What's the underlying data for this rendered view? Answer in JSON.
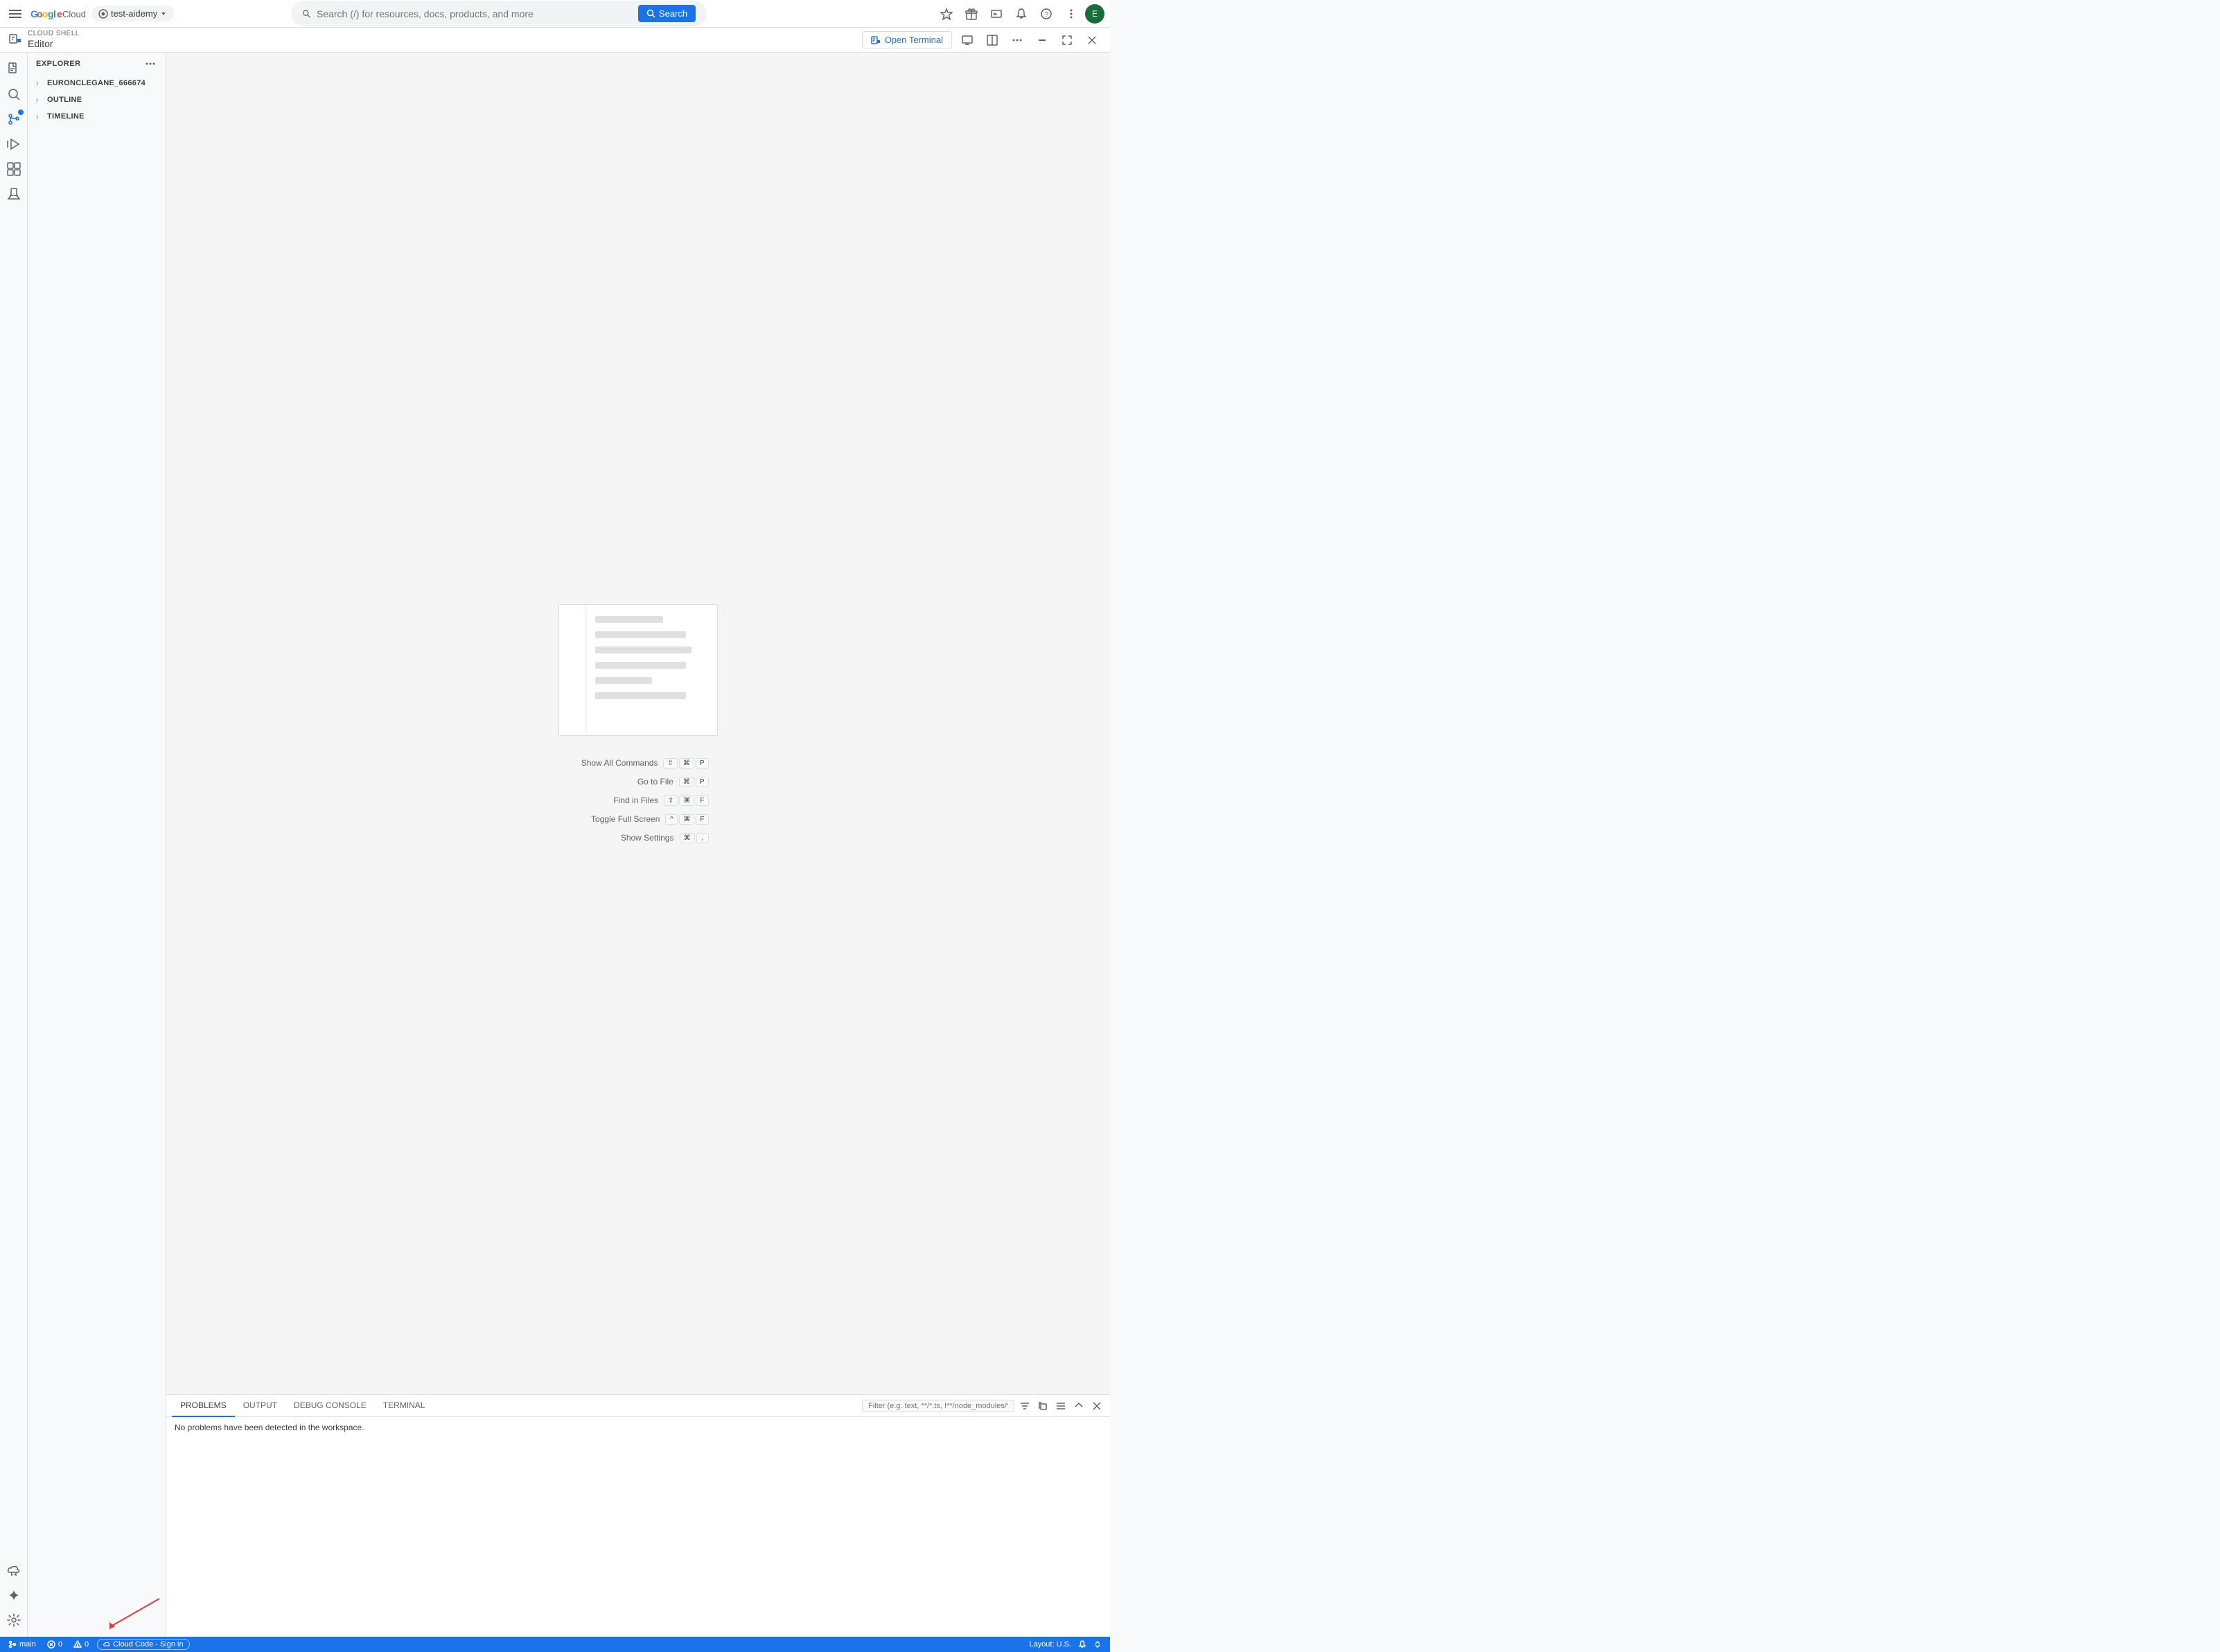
{
  "topbar": {
    "hamburger_label": "☰",
    "logo_text": "Google Cloud",
    "project_name": "test-aidemy",
    "search_placeholder": "Search (/) for resources, docs, products, and more",
    "search_btn_label": "Search",
    "starred_icon": "⭐",
    "gift_icon": "🎁",
    "terminal_icon": "▣",
    "bell_icon": "🔔",
    "help_icon": "?",
    "more_icon": "⋮",
    "avatar_initials": "E"
  },
  "cloudshell": {
    "label": "CLOUD SHELL",
    "title": "Editor",
    "open_terminal_label": "Open Terminal",
    "monitor_icon": "⬛",
    "window_icon": "⧉",
    "more_icon": "⋮",
    "minimize_icon": "−",
    "fullscreen_icon": "⤢",
    "close_icon": "×"
  },
  "sidebar": {
    "title": "EXPLORER",
    "more_icon": "⋯",
    "items": [
      {
        "label": "EURONCLEGANE_666674",
        "chevron": "›"
      },
      {
        "label": "OUTLINE",
        "chevron": "›"
      },
      {
        "label": "TIMELINE",
        "chevron": "›"
      }
    ]
  },
  "activity_bar": {
    "items": [
      {
        "name": "files-icon",
        "symbol": "⬜",
        "active": false
      },
      {
        "name": "search-icon",
        "symbol": "🔍",
        "active": false
      },
      {
        "name": "source-control-icon",
        "symbol": "⑂",
        "active": true
      },
      {
        "name": "run-icon",
        "symbol": "▶",
        "active": false
      },
      {
        "name": "extensions-icon",
        "symbol": "⊞",
        "active": false
      },
      {
        "name": "test-icon",
        "symbol": "⚗",
        "active": false
      },
      {
        "name": "cloud-icon",
        "symbol": "❖",
        "active": false
      },
      {
        "name": "gemini-icon",
        "symbol": "✦",
        "active": false
      }
    ],
    "bottom_items": [
      {
        "name": "settings-icon",
        "symbol": "⚙"
      }
    ]
  },
  "welcome": {
    "shortcuts": [
      {
        "label": "Show All Commands",
        "keys": [
          "⇧",
          "⌘",
          "P"
        ]
      },
      {
        "label": "Go to File",
        "keys": [
          "⌘",
          "P"
        ]
      },
      {
        "label": "Find in Files",
        "keys": [
          "⇧",
          "⌘",
          "F"
        ]
      },
      {
        "label": "Toggle Full Screen",
        "keys": [
          "^",
          "⌘",
          "F"
        ]
      },
      {
        "label": "Show Settings",
        "keys": [
          "⌘",
          ","
        ]
      }
    ]
  },
  "bottom_panel": {
    "tabs": [
      {
        "label": "PROBLEMS",
        "active": true
      },
      {
        "label": "OUTPUT",
        "active": false
      },
      {
        "label": "DEBUG CONSOLE",
        "active": false
      },
      {
        "label": "TERMINAL",
        "active": false
      }
    ],
    "filter_placeholder": "Filter (e.g. text, **/*.ts, !**/node_modules/**)",
    "no_problems_text": "No problems have been detected in the workspace.",
    "filter_icon": "⊟",
    "copy_icon": "⧉",
    "list_icon": "☰",
    "collapse_icon": "∧",
    "close_icon": "×"
  },
  "status_bar": {
    "branch_icon": "⑂",
    "branch_name": "main",
    "error_icon": "⊗",
    "error_count": "0",
    "warning_icon": "⚠",
    "warning_count": "0",
    "cloud_code_label": "Cloud Code - Sign in",
    "layout_label": "Layout: U.S.",
    "notification_icon": "🔔",
    "up_icon": "↑",
    "down_icon": "↓"
  }
}
